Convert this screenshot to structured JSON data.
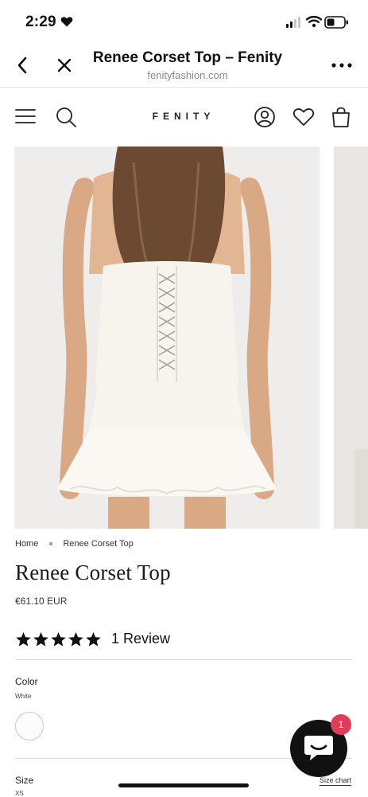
{
  "status_bar": {
    "time": "2:29"
  },
  "browser": {
    "title": "Renee Corset Top – Fenity",
    "domain": "fenityfashion.com"
  },
  "site": {
    "logo_text": "FENITY"
  },
  "breadcrumb": {
    "home": "Home",
    "current": "Renee Corset Top"
  },
  "product": {
    "title": "Renee Corset Top",
    "price": "€61.10 EUR",
    "rating": 5,
    "review_count": "1 Review",
    "color_label": "Color",
    "color_value": "White",
    "size_label": "Size",
    "size_value": "XS",
    "size_chart_label": "Size chart"
  },
  "chat": {
    "badge_count": "1"
  },
  "colors": {
    "accent_badge": "#e23b58",
    "chat_button": "#111111",
    "star": "#111111"
  },
  "icons": [
    "back-icon",
    "close-icon",
    "more-icon",
    "menu-icon",
    "search-icon",
    "account-icon",
    "heart-icon",
    "bag-icon",
    "star-icon",
    "chat-icon"
  ]
}
